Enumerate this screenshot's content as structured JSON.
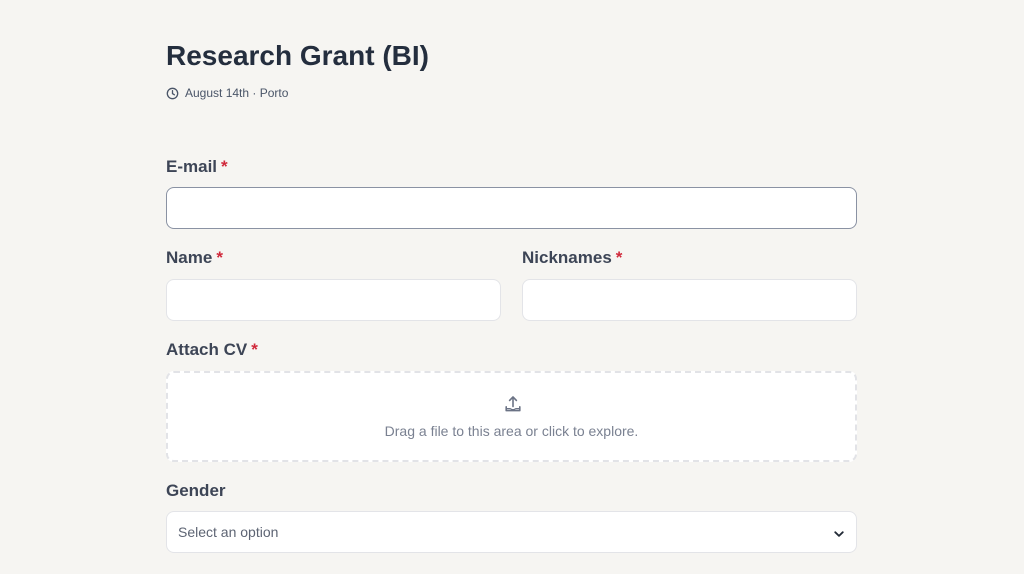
{
  "header": {
    "title": "Research Grant (BI)",
    "meta": "August 14th · Porto",
    "meta_icon": "clock-icon"
  },
  "form": {
    "required_marker": "*",
    "email": {
      "label": "E-mail",
      "value": "",
      "placeholder": ""
    },
    "name": {
      "label": "Name",
      "value": "",
      "placeholder": ""
    },
    "nicknames": {
      "label": "Nicknames",
      "value": "",
      "placeholder": ""
    },
    "cv": {
      "label": "Attach CV",
      "dropzone_text": "Drag a file to this area or click to explore.",
      "icon": "upload-icon"
    },
    "gender": {
      "label": "Gender",
      "selected": "Select an option",
      "icon": "chevron-down-icon"
    }
  },
  "colors": {
    "background": "#f6f5f2",
    "required": "#d0283a",
    "title": "#242e3e"
  }
}
